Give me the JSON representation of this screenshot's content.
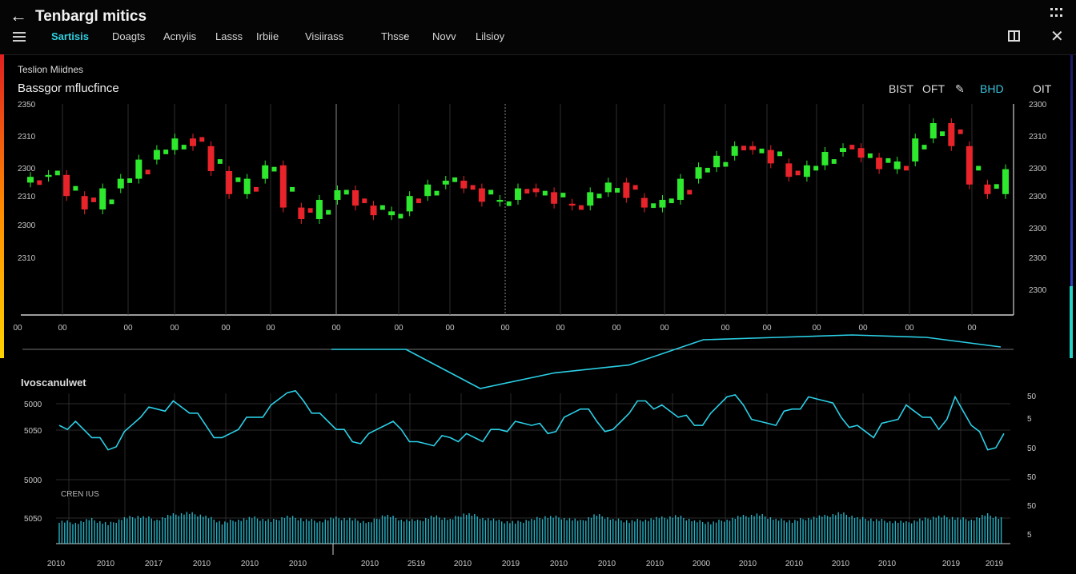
{
  "header": {
    "title": "Tenbargl mitics",
    "tabs": [
      {
        "label": "Sartisis",
        "active": true
      },
      {
        "label": "Doagts"
      },
      {
        "label": "Acnyiis"
      },
      {
        "label": "Lasss"
      },
      {
        "label": "Irbiie"
      },
      {
        "label": "Visiirass"
      },
      {
        "label": "Thsse"
      },
      {
        "label": "Novv"
      },
      {
        "label": "Lilsioy"
      }
    ]
  },
  "panel": {
    "label": "Teslion Miidnes",
    "chart_title": "Bassgor mflucfince",
    "controls": {
      "a": "BIST",
      "b": "OFT",
      "c": "BHD",
      "d": "OIT"
    }
  },
  "lower_panel": {
    "title": "Ivoscanulwet",
    "inset_label": "CREN IUS"
  },
  "colors": {
    "up": "#2ee82e",
    "down": "#e8232a",
    "line": "#2bcfe6",
    "grid": "#3a3a3a"
  },
  "chart_data": [
    {
      "type": "candlestick",
      "title": "Bassgor mflucfince",
      "y_ticks_left": [
        "2350",
        "2310",
        "2300",
        "2310",
        "2300",
        "2310"
      ],
      "y_ticks_right": [
        "2300",
        "2310",
        "2300",
        "2300",
        "2300",
        "2300",
        "2300"
      ],
      "x_ticks": [
        "00",
        "00",
        "00",
        "00",
        "00",
        "00",
        "00",
        "00",
        "00",
        "00",
        "00",
        "00",
        "00",
        "00",
        "00",
        "00",
        "00",
        "00",
        "00"
      ],
      "ylim": [
        2280,
        2390
      ],
      "close": [
        2352,
        2353,
        2342,
        2335,
        2346,
        2351,
        2361,
        2366,
        2372,
        2368,
        2355,
        2343,
        2351,
        2358,
        2336,
        2330,
        2340,
        2345,
        2337,
        2332,
        2334,
        2342,
        2348,
        2350,
        2346,
        2339,
        2340,
        2346,
        2344,
        2338,
        2337,
        2344,
        2349,
        2341,
        2336,
        2340,
        2351,
        2357,
        2363,
        2368,
        2366,
        2359,
        2352,
        2358,
        2365,
        2367,
        2362,
        2356,
        2360,
        2372,
        2380,
        2368,
        2348,
        2343,
        2356
      ]
    },
    {
      "type": "line",
      "series": [
        {
          "values": [
            0,
            0,
            -1,
            -0.6,
            -0.4,
            0.4,
            0.5,
            0.6,
            0.5,
            0.1
          ]
        }
      ]
    },
    {
      "type": "line",
      "y_ticks_left": [
        "5000",
        "5050",
        "5000",
        "5050"
      ],
      "y_ticks_right": [
        "50",
        "5",
        "50",
        "50",
        "50",
        "5"
      ],
      "x_ticks": [
        "2010",
        "2010",
        "2017",
        "2010",
        "2010",
        "2010",
        "2010",
        "2519",
        "2010",
        "2019",
        "2010",
        "2010",
        "2010",
        "2000",
        "2010",
        "2010",
        "2010",
        "2010",
        "2019",
        "2019"
      ],
      "series": [
        {
          "name": "main",
          "values": [
            58,
            60,
            52,
            46,
            55,
            62,
            66,
            70,
            64,
            58,
            52,
            56,
            62,
            68,
            74,
            70,
            64,
            56,
            50,
            54,
            58,
            56,
            50,
            48,
            52,
            54,
            50,
            56,
            60,
            58,
            54,
            62,
            66,
            60,
            56,
            64,
            70,
            68,
            62,
            58,
            64,
            72,
            68,
            60,
            58,
            66,
            72,
            70,
            62,
            58,
            52,
            60,
            68,
            62,
            56,
            72,
            58,
            46,
            54
          ]
        },
        {
          "name": "volume",
          "values": [
            28,
            26,
            30,
            24,
            32,
            34,
            30,
            36,
            38,
            34,
            26,
            30,
            32,
            28,
            34,
            30,
            28,
            32,
            30,
            26,
            36,
            30,
            28,
            34,
            30,
            38,
            32,
            28,
            26,
            30,
            34,
            32,
            28,
            36,
            30,
            28,
            30,
            32,
            34,
            28,
            26,
            30,
            34,
            36,
            30,
            28,
            32,
            34,
            38,
            32,
            30,
            28,
            26,
            30,
            34,
            32,
            30,
            36,
            30
          ]
        }
      ]
    }
  ]
}
